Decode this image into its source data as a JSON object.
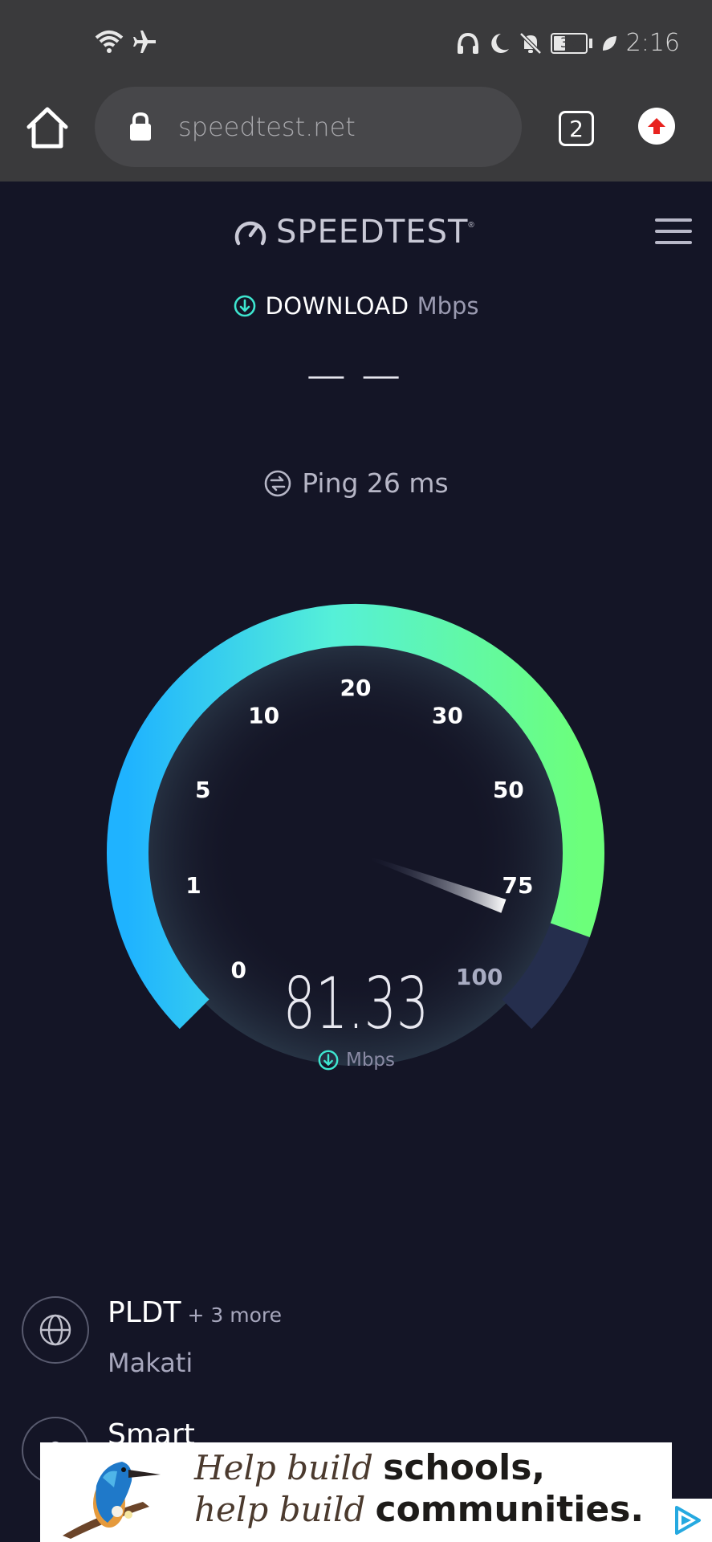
{
  "status_bar": {
    "battery": "37",
    "time": "2:16",
    "icons": [
      "wifi-icon",
      "airplane-icon",
      "headphones-icon",
      "moon-icon",
      "bell-muted-icon",
      "battery-icon",
      "leaf-icon"
    ]
  },
  "browser": {
    "url": "speedtest.net",
    "tab_count": "2"
  },
  "header": {
    "brand": "SPEEDTEST",
    "brand_mark": "®"
  },
  "result": {
    "download_title": "DOWNLOAD",
    "download_unit": "Mbps",
    "download_value": "— —",
    "ping_label": "Ping 26 ms"
  },
  "gauge": {
    "ticks": [
      "0",
      "1",
      "5",
      "10",
      "20",
      "30",
      "50",
      "75",
      "100"
    ],
    "current_value": "81.33",
    "unit": "Mbps",
    "colors": {
      "start": "#1fb3ff",
      "mid": "#55f0d8",
      "end": "#6cff7a",
      "track": "#252e4d"
    }
  },
  "isp_list": [
    {
      "name": "PLDT",
      "more": "+ 3 more",
      "location": "Makati"
    },
    {
      "name": "Smart"
    }
  ],
  "ad": {
    "line1_script": "Help build",
    "line1_bold": "schools,",
    "line2_script": "help build",
    "line2_bold": "communities."
  }
}
